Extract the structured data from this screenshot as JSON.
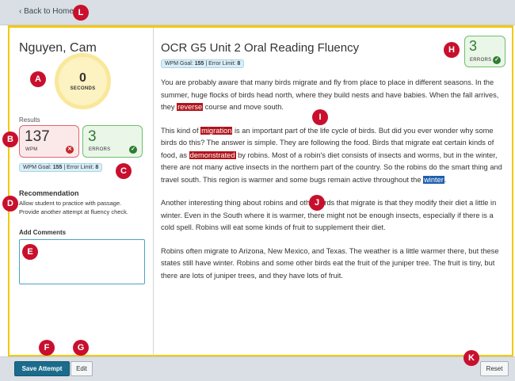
{
  "nav": {
    "back_label": "Back to Home",
    "back_icon": "chevron-left-icon"
  },
  "student": {
    "name": "Nguyen, Cam"
  },
  "timer": {
    "value": "0",
    "unit": "SECONDS"
  },
  "results": {
    "label": "Results",
    "wpm": {
      "value": "137",
      "label": "WPM",
      "icon": "x-circle-icon"
    },
    "errors": {
      "value": "3",
      "label": "ERRORS",
      "icon": "check-circle-icon"
    },
    "goal": {
      "wpm_label": "WPM Goal:",
      "wpm_value": "155",
      "separator": "|",
      "limit_label": "Error Limit:",
      "limit_value": "8"
    }
  },
  "recommendation": {
    "title": "Recommendation",
    "line1": "Allow student to practice with passage.",
    "line2": "Provide another attempt at fluency check."
  },
  "comments": {
    "label": "Add Comments",
    "value": "",
    "placeholder": ""
  },
  "assessment": {
    "title": "OCR G5 Unit 2 Oral Reading Fluency",
    "errors": {
      "value": "3",
      "label": "ERRORS",
      "icon": "check-circle-icon"
    },
    "goal": {
      "wpm_label": "WPM Goal:",
      "wpm_value": "155",
      "separator": "|",
      "limit_label": "Error Limit:",
      "limit_value": "8"
    }
  },
  "passage": {
    "p1_before": "You are probably aware that many birds migrate and fly from place to place in different seasons. In the summer, huge flocks of birds head north, where they build nests and have babies. When the fall arrives, they ",
    "p1_hl": "reverse",
    "p1_after": " course and move south.",
    "p2_a": "This kind of ",
    "p2_hl1": "migration",
    "p2_b": " is an important part of the life cycle of birds. But did you ever wonder why some birds do this? The answer is simple. They are following the food. Birds that migrate eat certain kinds of food, as ",
    "p2_hl2": "demonstrated",
    "p2_c": " by robins. Most of a robin's diet consists of insects and worms, but in the winter, there are not many active insects in the northern part of the country. So the robins do the smart thing and travel south. This region is warmer and some bugs remain active throughout the ",
    "p2_hl3": "winter",
    "p2_d": ".",
    "p3": "Another interesting thing about robins and other birds that migrate is that they modify their diet a little in winter. Even in the South where it is warmer, there might not be enough insects, especially if there is a cold spell. Robins will eat some kinds of fruit to supplement their diet.",
    "p4": "Robins often migrate to Arizona, New Mexico, and Texas. The weather is a little warmer there, but these states still have winter. Robins and some other birds eat the fruit of the juniper tree. The fruit is tiny, but there are lots of juniper trees, and they have lots of fruit."
  },
  "footer": {
    "save_label": "Save Attempt",
    "edit_label": "Edit",
    "reset_label": "Reset"
  },
  "callouts": {
    "a": "A",
    "b": "B",
    "c": "C",
    "d": "D",
    "e": "E",
    "f": "F",
    "g": "G",
    "h": "H",
    "i": "I",
    "j": "J",
    "k": "K",
    "l": "L"
  },
  "colors": {
    "accent": "#1b6c8c",
    "highlight_frame": "#f2c80f",
    "error_red": "#b0141b",
    "selected_blue": "#1e5fae",
    "success_green": "#2e7d32",
    "callout_red": "#c8102e"
  }
}
